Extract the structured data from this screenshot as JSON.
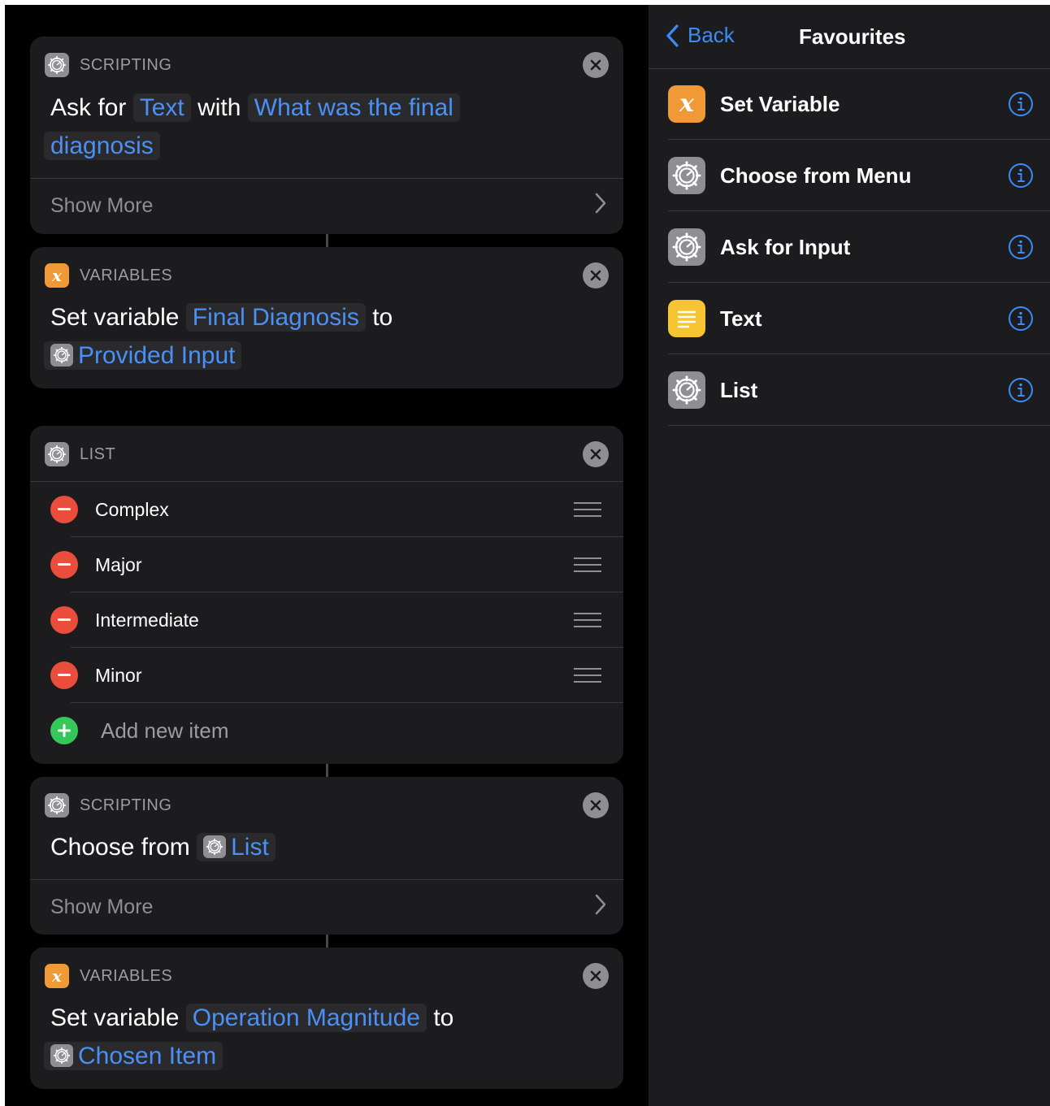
{
  "editor": {
    "cards": [
      {
        "category": "SCRIPTING",
        "icon": "gear-icon",
        "text_parts": [
          "Ask for",
          "Text",
          "with",
          "What was the final",
          "diagnosis"
        ],
        "show_more": "Show More"
      },
      {
        "category": "VARIABLES",
        "icon": "variable-x-icon",
        "icon_glyph": "x",
        "text_parts": [
          "Set variable",
          "Final Diagnosis",
          "to",
          "Provided Input"
        ]
      },
      {
        "category": "LIST",
        "icon": "gear-icon",
        "items": [
          "Complex",
          "Major",
          "Intermediate",
          "Minor"
        ],
        "add_item": "Add new item"
      },
      {
        "category": "SCRIPTING",
        "icon": "gear-icon",
        "text_parts": [
          "Choose from",
          "List"
        ],
        "show_more": "Show More"
      },
      {
        "category": "VARIABLES",
        "icon": "variable-x-icon",
        "icon_glyph": "x",
        "text_parts": [
          "Set variable",
          "Operation Magnitude",
          "to",
          "Chosen Item"
        ]
      }
    ]
  },
  "sidebar": {
    "back_label": "Back",
    "title": "Favourites",
    "items": [
      {
        "label": "Set Variable",
        "icon": "variable-x-icon",
        "glyph": "x",
        "color": "#f09a37"
      },
      {
        "label": "Choose from Menu",
        "icon": "gear-icon",
        "color": "#8e8e93"
      },
      {
        "label": "Ask for Input",
        "icon": "gear-icon",
        "color": "#8e8e93"
      },
      {
        "label": "Text",
        "icon": "text-lines-icon",
        "color": "#f7c531"
      },
      {
        "label": "List",
        "icon": "gear-icon",
        "color": "#8e8e93"
      }
    ]
  },
  "colors": {
    "accent_blue": "#3b8cf6",
    "delete_red": "#eb4d3d",
    "add_green": "#34c759",
    "card_bg": "#1c1c1e"
  }
}
